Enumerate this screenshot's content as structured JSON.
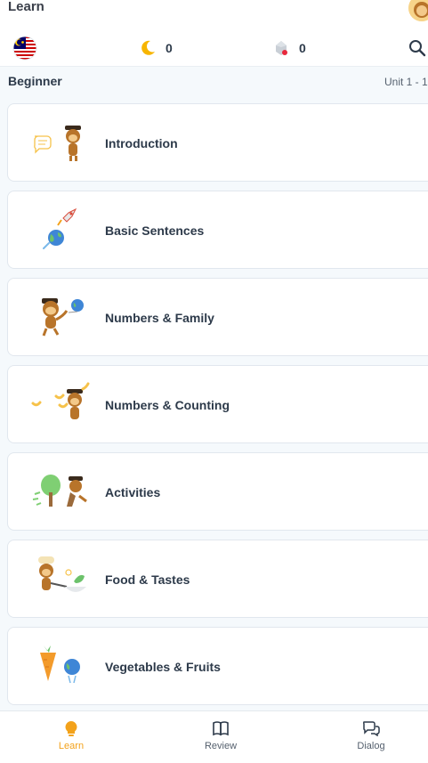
{
  "header": {
    "title": "Learn",
    "streak_count": "0",
    "gems_count": "0",
    "flag": "malaysia-flag-icon",
    "accent": "#f3a21b"
  },
  "section": {
    "title": "Beginner",
    "range": "Unit 1 - 1"
  },
  "lessons": [
    {
      "label": "Introduction",
      "icon": "monkey-speech-icon"
    },
    {
      "label": "Basic Sentences",
      "icon": "rocket-globe-icon"
    },
    {
      "label": "Numbers & Family",
      "icon": "monkey-balloon-icon"
    },
    {
      "label": "Numbers & Counting",
      "icon": "monkey-bananas-icon"
    },
    {
      "label": "Activities",
      "icon": "monkey-running-icon"
    },
    {
      "label": "Food & Tastes",
      "icon": "monkey-chef-icon"
    },
    {
      "label": "Vegetables & Fruits",
      "icon": "carrot-icon"
    }
  ],
  "nav": {
    "learn": "Learn",
    "review": "Review",
    "dialog": "Dialog"
  }
}
